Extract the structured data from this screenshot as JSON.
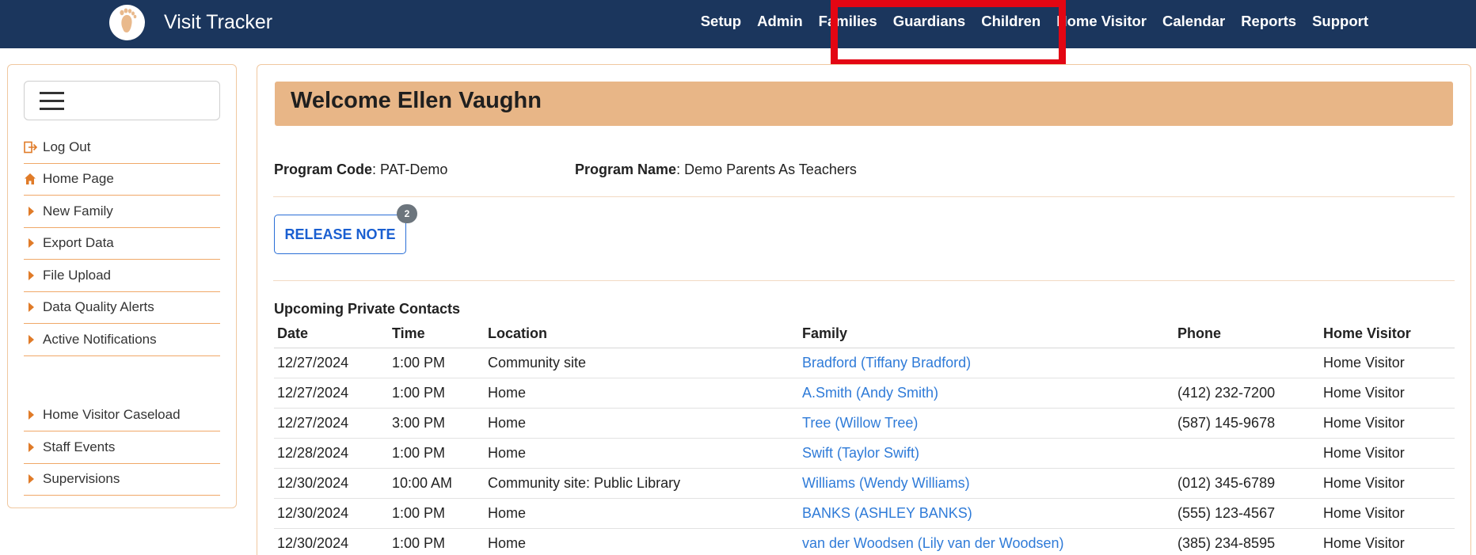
{
  "header": {
    "app_title": "Visit Tracker",
    "nav": [
      "Setup",
      "Admin",
      "Families",
      "Guardians",
      "Children",
      "Home Visitor",
      "Calendar",
      "Reports",
      "Support"
    ],
    "colors": {
      "navbar": "#1b365d",
      "highlight": "#e30613"
    }
  },
  "sidebar": {
    "items": [
      {
        "label": "Log Out",
        "icon": "logout-icon"
      },
      {
        "label": "Home Page",
        "icon": "home-icon"
      },
      {
        "label": "New Family",
        "icon": "caret-right-icon"
      },
      {
        "label": "Export Data",
        "icon": "caret-right-icon"
      },
      {
        "label": "File Upload",
        "icon": "caret-right-icon"
      },
      {
        "label": "Data Quality Alerts",
        "icon": "caret-right-icon"
      },
      {
        "label": "Active Notifications",
        "icon": "caret-right-icon"
      }
    ],
    "items2": [
      {
        "label": "Home Visitor Caseload",
        "icon": "caret-right-icon"
      },
      {
        "label": "Staff Events",
        "icon": "caret-right-icon"
      },
      {
        "label": "Supervisions",
        "icon": "caret-right-icon"
      }
    ]
  },
  "main": {
    "welcome": "Welcome Ellen Vaughn",
    "program_code_label": "Program Code",
    "program_code": ": PAT-Demo",
    "program_name_label": "Program Name",
    "program_name": ": Demo Parents As Teachers",
    "release_note": "RELEASE NOTE",
    "release_badge": "2",
    "section_title": "Upcoming Private Contacts",
    "columns": [
      "Date",
      "Time",
      "Location",
      "Family",
      "Phone",
      "Home Visitor"
    ],
    "rows": [
      {
        "date": "12/27/2024",
        "time": "1:00 PM",
        "location": "Community site",
        "family": "Bradford (Tiffany Bradford)",
        "phone": "",
        "home_visitor": "Home Visitor"
      },
      {
        "date": "12/27/2024",
        "time": "1:00 PM",
        "location": "Home",
        "family": "A.Smith (Andy Smith)",
        "phone": "(412) 232-7200",
        "home_visitor": "Home Visitor"
      },
      {
        "date": "12/27/2024",
        "time": "3:00 PM",
        "location": "Home",
        "family": "Tree (Willow Tree)",
        "phone": "(587) 145-9678",
        "home_visitor": "Home Visitor"
      },
      {
        "date": "12/28/2024",
        "time": "1:00 PM",
        "location": "Home",
        "family": "Swift (Taylor Swift)",
        "phone": "",
        "home_visitor": "Home Visitor"
      },
      {
        "date": "12/30/2024",
        "time": "10:00 AM",
        "location": "Community site: Public Library",
        "family": "Williams (Wendy Williams)",
        "phone": "(012) 345-6789",
        "home_visitor": "Home Visitor"
      },
      {
        "date": "12/30/2024",
        "time": "1:00 PM",
        "location": "Home",
        "family": "BANKS (ASHLEY BANKS)",
        "phone": "(555) 123-4567",
        "home_visitor": "Home Visitor"
      },
      {
        "date": "12/30/2024",
        "time": "1:00 PM",
        "location": "Home",
        "family": "van der Woodsen (Lily van der Woodsen)",
        "phone": "(385) 234-8595",
        "home_visitor": "Home Visitor"
      }
    ]
  }
}
